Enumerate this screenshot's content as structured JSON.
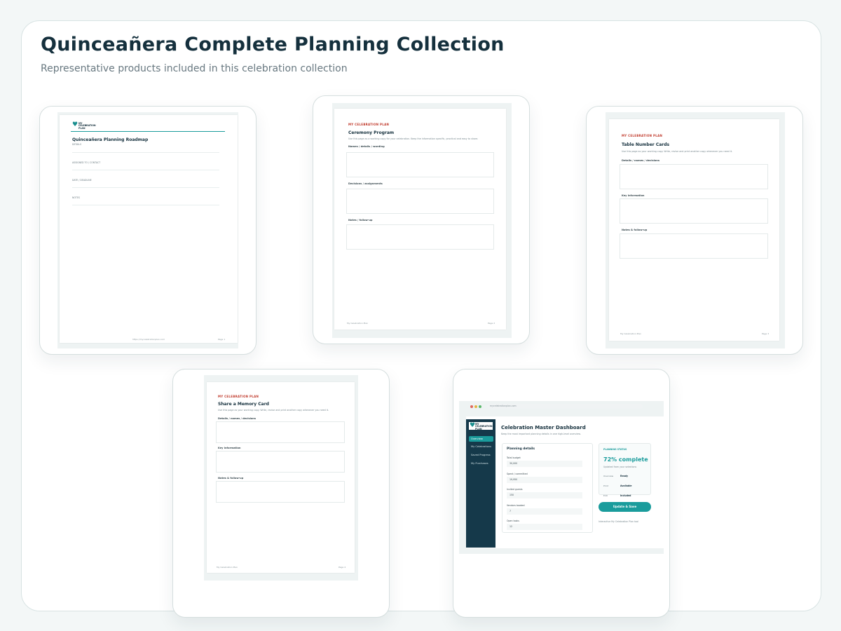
{
  "header": {
    "title": "Quinceañera Complete Planning Collection",
    "subtitle": "Representative products included in this celebration collection"
  },
  "colors": {
    "accent": "#1a9c9c",
    "brand_red": "#c0392b",
    "navy": "#15394a"
  },
  "products": {
    "roadmap": {
      "logo_text": "MY CELEBRATION PLAN",
      "title": "Quinceañera Planning Roadmap",
      "details_label": "DETAILS",
      "field1": "ASSIGNED TO / CONTACT",
      "field2": "DATE / DEADLINE",
      "field3": "NOTES",
      "footer_url": "https://mycelebrationplan.com",
      "footer_page": "Page 1"
    },
    "ceremony": {
      "brand": "MY CELEBRATION PLAN",
      "title": "Ceremony Program",
      "desc": "Use this page as a working copy for your celebration. Keep the information specific, practical and easy to share.",
      "label1": "Names / details / wording",
      "label2": "Decisions / assignments",
      "label3": "Notes / follow-up",
      "footer_left": "My Celebration Plan",
      "footer_page": "Page 2"
    },
    "table_cards": {
      "brand": "MY CELEBRATION PLAN",
      "title": "Table Number Cards",
      "desc": "Use this page as your working copy. Write, revise and print another copy whenever you need it.",
      "label1": "Details / names / decisions",
      "label2": "Key information",
      "label3": "Notes & follow-up",
      "footer_left": "My Celebration Plan",
      "footer_page": "Page 3"
    },
    "memory_card": {
      "brand": "MY CELEBRATION PLAN",
      "title": "Share a Memory Card",
      "desc": "Use this page as your working copy. Write, revise and print another copy whenever you need it.",
      "label1": "Details / names / decisions",
      "label2": "Key information",
      "label3": "Notes & follow-up",
      "footer_left": "My Celebration Plan",
      "footer_page": "Page 4"
    },
    "dashboard": {
      "url": "mycelebrationplan.com",
      "logo_text": "MY CELEBRATION PLAN",
      "nav": [
        "Overview",
        "My Celebrations",
        "Saved Progress",
        "My Purchases"
      ],
      "title": "Celebration Master Dashboard",
      "desc": "Keep the most important planning details in one high-level overview.",
      "planning_title": "Planning details",
      "fields": [
        {
          "label": "Total budget",
          "value": "30,000"
        },
        {
          "label": "Spent / committed",
          "value": "19,950"
        },
        {
          "label": "Invited guests",
          "value": "150"
        },
        {
          "label": "Vendors booked",
          "value": "7"
        },
        {
          "label": "Open tasks",
          "value": "12"
        }
      ],
      "status_heading": "PLANNING STATUS",
      "status_value": "72% complete",
      "status_note": "Updated from your selections",
      "status_rows": [
        {
          "key": "Overview",
          "val": "Ready"
        },
        {
          "key": "Print",
          "val": "Available"
        },
        {
          "key": "Edit",
          "val": "Included"
        }
      ],
      "update_button": "Update & Save",
      "footer": "Interactive My Celebration Plan tool"
    }
  }
}
